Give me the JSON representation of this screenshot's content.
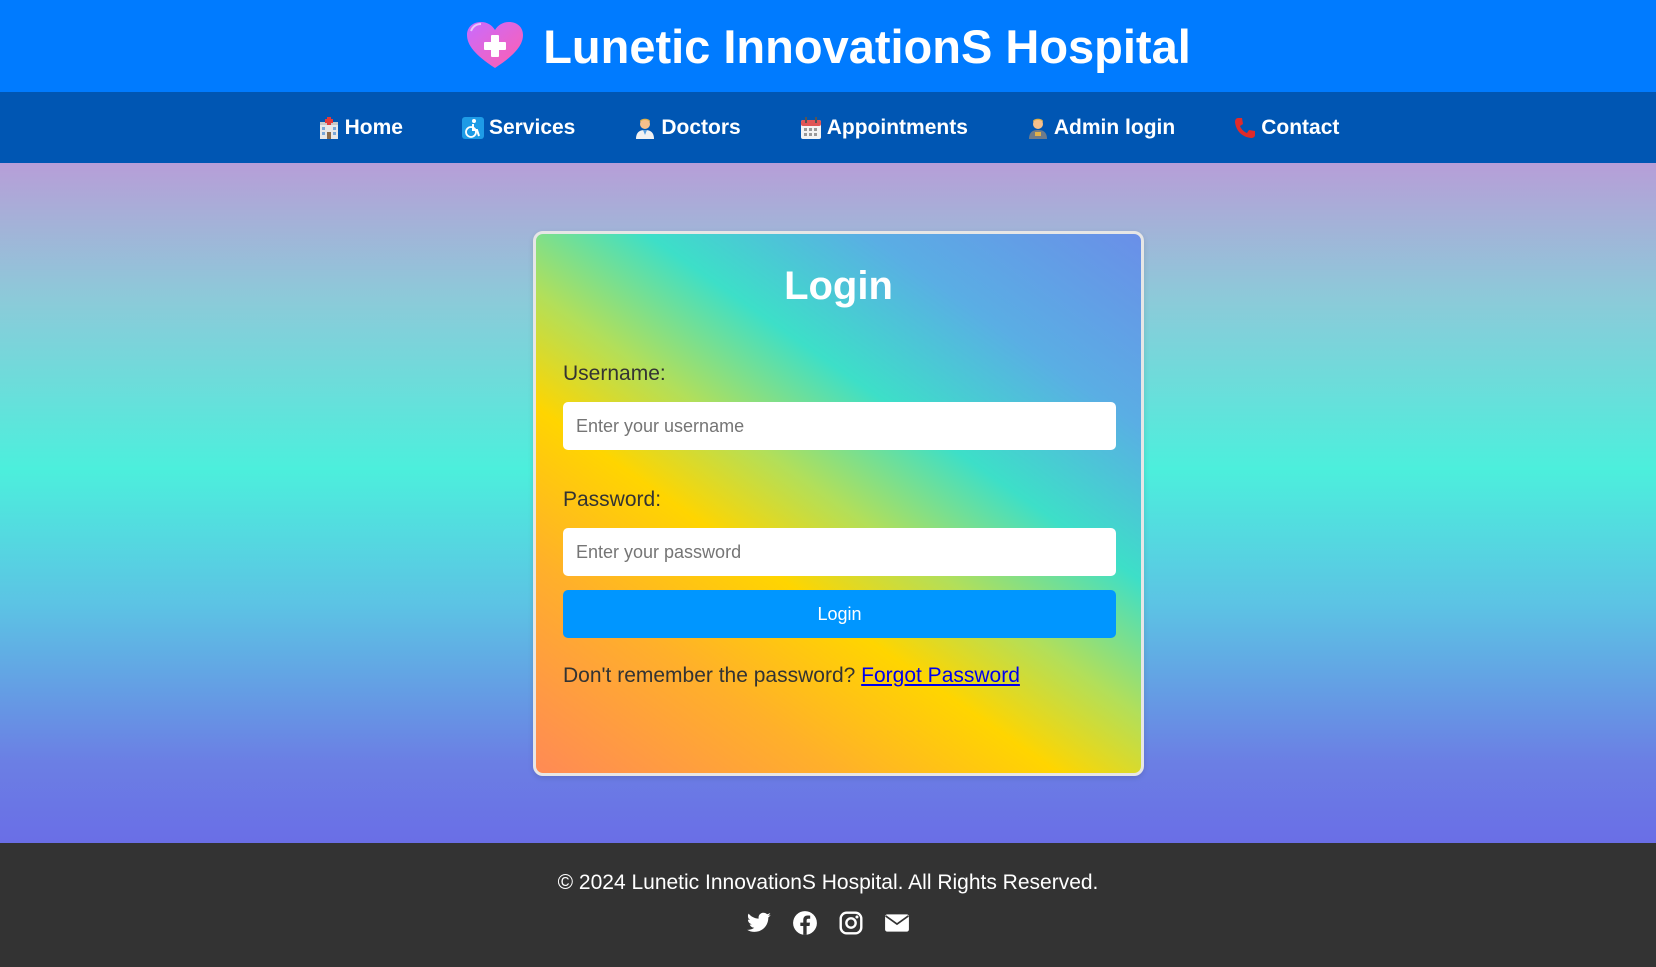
{
  "header": {
    "title": "Lunetic InnovationS Hospital",
    "logo_icon": "heart-medical-icon"
  },
  "nav": {
    "items": [
      {
        "label": "Home",
        "icon": "hospital-icon"
      },
      {
        "label": "Services",
        "icon": "services-icon"
      },
      {
        "label": "Doctors",
        "icon": "doctor-icon"
      },
      {
        "label": "Appointments",
        "icon": "calendar-icon"
      },
      {
        "label": "Admin login",
        "icon": "admin-icon"
      },
      {
        "label": "Contact",
        "icon": "phone-icon"
      }
    ]
  },
  "login": {
    "title": "Login",
    "username_label": "Username:",
    "username_placeholder": "Enter your username",
    "password_label": "Password:",
    "password_placeholder": "Enter your password",
    "button_label": "Login",
    "forgot_prompt": "Don't remember the password?",
    "forgot_link": "Forgot Password"
  },
  "footer": {
    "copyright": "© 2024 Lunetic InnovationS Hospital. All Rights Reserved.",
    "social": [
      "twitter-icon",
      "facebook-icon",
      "instagram-icon",
      "email-icon"
    ]
  },
  "colors": {
    "header_bg": "#007bff",
    "nav_bg": "#0056b3",
    "button_bg": "#0096ff",
    "footer_bg": "#333333"
  }
}
